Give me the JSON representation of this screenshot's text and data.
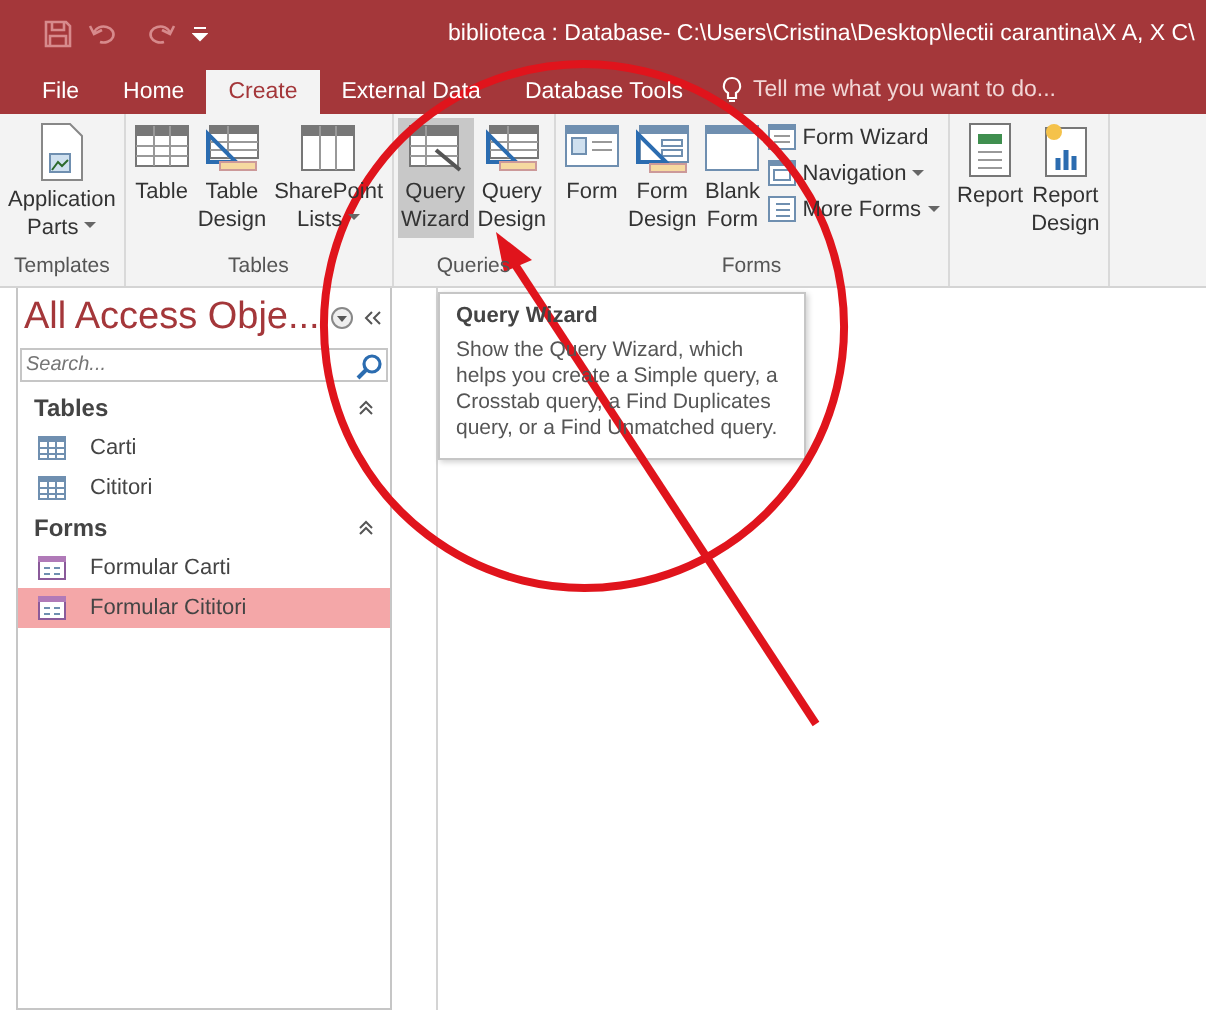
{
  "window": {
    "title": "biblioteca : Database- C:\\Users\\Cristina\\Desktop\\lectii carantina\\X A, X C\\"
  },
  "tabs": [
    {
      "label": "File",
      "selected": false
    },
    {
      "label": "Home",
      "selected": false
    },
    {
      "label": "Create",
      "selected": true
    },
    {
      "label": "External Data",
      "selected": false
    },
    {
      "label": "Database Tools",
      "selected": false
    }
  ],
  "tell_me": {
    "placeholder": "Tell me what you want to do..."
  },
  "ribbon": {
    "groups": [
      {
        "label": "Templates",
        "buttons": [
          {
            "kind": "large",
            "label": "Application Parts",
            "dropdown": true,
            "selected": false
          }
        ]
      },
      {
        "label": "Tables",
        "buttons": [
          {
            "kind": "large",
            "label": "Table",
            "dropdown": false,
            "selected": false
          },
          {
            "kind": "large",
            "label": "Table Design",
            "dropdown": false,
            "selected": false
          },
          {
            "kind": "large",
            "label": "SharePoint Lists",
            "dropdown": true,
            "selected": false
          }
        ]
      },
      {
        "label": "Queries",
        "buttons": [
          {
            "kind": "large",
            "label": "Query Wizard",
            "dropdown": false,
            "selected": true
          },
          {
            "kind": "large",
            "label": "Query Design",
            "dropdown": false,
            "selected": false
          }
        ]
      },
      {
        "label": "Forms",
        "buttons": [
          {
            "kind": "large",
            "label": "Form",
            "dropdown": false,
            "selected": false
          },
          {
            "kind": "large",
            "label": "Form Design",
            "dropdown": false,
            "selected": false
          },
          {
            "kind": "large",
            "label": "Blank Form",
            "dropdown": false,
            "selected": false
          },
          {
            "kind": "small",
            "label": "Form Wizard",
            "dropdown": false,
            "selected": false
          },
          {
            "kind": "small",
            "label": "Navigation",
            "dropdown": true,
            "selected": false
          },
          {
            "kind": "small",
            "label": "More Forms",
            "dropdown": true,
            "selected": false
          }
        ]
      },
      {
        "buttons": [
          {
            "kind": "large",
            "label": "Report",
            "dropdown": false,
            "selected": false
          },
          {
            "kind": "large",
            "label": "Report Design",
            "dropdown": false,
            "selected": false
          }
        ]
      }
    ]
  },
  "nav_pane": {
    "title": "All Access Obje...",
    "search": {
      "placeholder": "Search..."
    },
    "sections": [
      {
        "label": "Tables",
        "kind": "table",
        "expanded": true,
        "items": [
          {
            "label": "Carti",
            "selected": false
          },
          {
            "label": "Cititori",
            "selected": false
          }
        ]
      },
      {
        "label": "Forms",
        "kind": "form",
        "expanded": true,
        "items": [
          {
            "label": "Formular Carti",
            "selected": false
          },
          {
            "label": "Formular Cititori",
            "selected": true
          }
        ]
      }
    ]
  },
  "tooltip": {
    "title": "Query Wizard",
    "text": "Show the Query Wizard, which helps you create a Simple query, a Crosstab query, a Find Duplicates query, or a Find Unmatched query."
  }
}
